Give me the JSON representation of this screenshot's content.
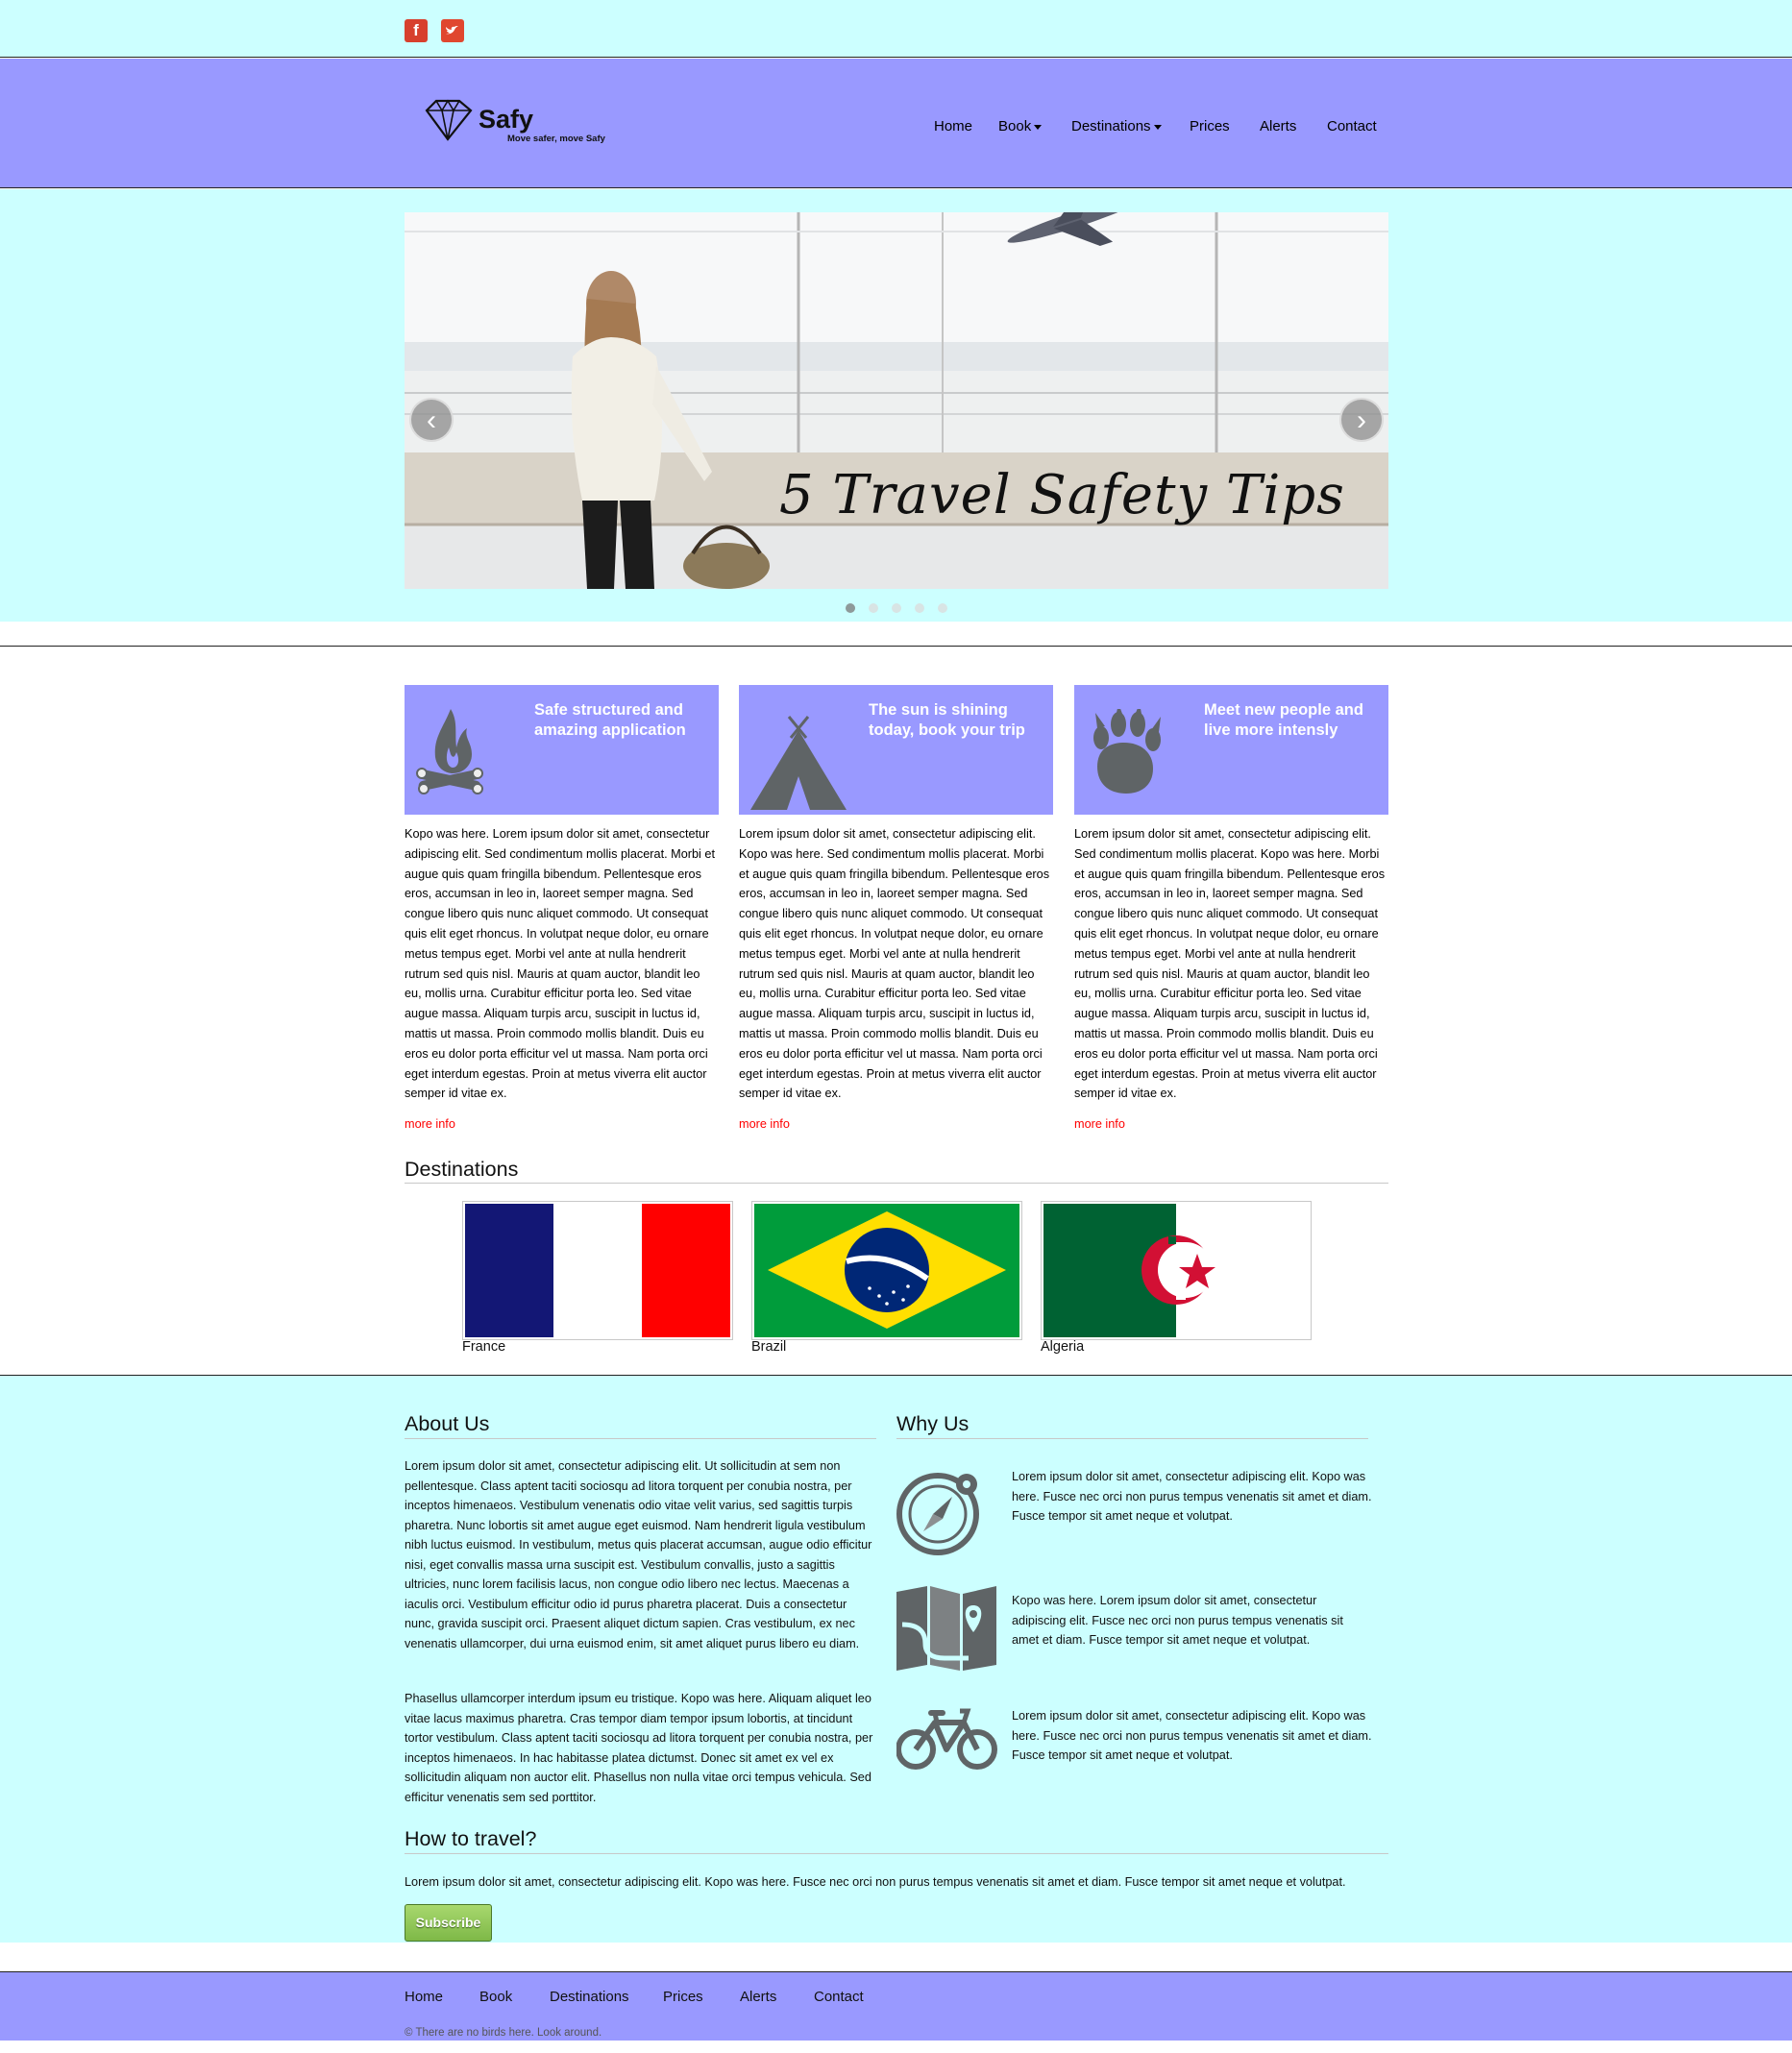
{
  "social": {
    "facebook": "f",
    "twitter": "t"
  },
  "logo": {
    "name": "Safy",
    "tagline": "Move safer, move Safy"
  },
  "nav": [
    {
      "label": "Home"
    },
    {
      "label": "Book"
    },
    {
      "label": "Destinations"
    },
    {
      "label": "Prices"
    },
    {
      "label": "Alerts"
    },
    {
      "label": "Contact"
    }
  ],
  "hero": {
    "caption": "5 Travel Safety Tips",
    "prev_icon": "chevron-left-icon",
    "next_icon": "chevron-right-icon",
    "slide_count": 5,
    "active_slide": 1
  },
  "features": [
    {
      "title": "Safe structured and amazing application",
      "icon": "campfire-icon",
      "text": "Kopo was here. Lorem ipsum dolor sit amet, consectetur adipiscing elit. Sed condimentum mollis placerat. Morbi et augue quis quam fringilla bibendum. Pellentesque eros eros, accumsan in leo in, laoreet semper magna. Sed congue libero quis nunc aliquet commodo. Ut consequat quis elit eget rhoncus. In volutpat neque dolor, eu ornare metus tempus eget. Morbi vel ante at nulla hendrerit rutrum sed quis nisl. Mauris at quam auctor, blandit leo eu, mollis urna. Curabitur efficitur porta leo. Sed vitae augue massa. Aliquam turpis arcu, suscipit in luctus id, mattis ut massa. Proin commodo mollis blandit. Duis eu eros eu dolor porta efficitur vel ut massa. Nam porta orci eget interdum egestas. Proin at metus viverra elit auctor semper id vitae ex.",
      "more": "more info"
    },
    {
      "title": "The sun is shining today, book your trip",
      "icon": "tent-icon",
      "text": "Lorem ipsum dolor sit amet, consectetur adipiscing elit. Kopo was here. Sed condimentum mollis placerat. Morbi et augue quis quam fringilla bibendum. Pellentesque eros eros, accumsan in leo in, laoreet semper magna. Sed congue libero quis nunc aliquet commodo. Ut consequat quis elit eget rhoncus. In volutpat neque dolor, eu ornare metus tempus eget. Morbi vel ante at nulla hendrerit rutrum sed quis nisl. Mauris at quam auctor, blandit leo eu, mollis urna. Curabitur efficitur porta leo. Sed vitae augue massa. Aliquam turpis arcu, suscipit in luctus id, mattis ut massa. Proin commodo mollis blandit. Duis eu eros eu dolor porta efficitur vel ut massa. Nam porta orci eget interdum egestas. Proin at metus viverra elit auctor semper id vitae ex.",
      "more": "more info"
    },
    {
      "title": "Meet new people and live more intensly",
      "icon": "paw-icon",
      "text": "Lorem ipsum dolor sit amet, consectetur adipiscing elit. Sed condimentum mollis placerat. Kopo was here. Morbi et augue quis quam fringilla bibendum. Pellentesque eros eros, accumsan in leo in, laoreet semper magna. Sed congue libero quis nunc aliquet commodo. Ut consequat quis elit eget rhoncus. In volutpat neque dolor, eu ornare metus tempus eget. Morbi vel ante at nulla hendrerit rutrum sed quis nisl. Mauris at quam auctor, blandit leo eu, mollis urna. Curabitur efficitur porta leo. Sed vitae augue massa. Aliquam turpis arcu, suscipit in luctus id, mattis ut massa. Proin commodo mollis blandit. Duis eu eros eu dolor porta efficitur vel ut massa. Nam porta orci eget interdum egestas. Proin at metus viverra elit auctor semper id vitae ex.",
      "more": "more info"
    }
  ],
  "destinations": {
    "heading": "Destinations",
    "items": [
      {
        "name": "France"
      },
      {
        "name": "Brazil"
      },
      {
        "name": "Algeria"
      }
    ]
  },
  "about": {
    "heading": "About Us",
    "p1": "Lorem ipsum dolor sit amet, consectetur adipiscing elit. Ut sollicitudin at sem non pellentesque. Class aptent taciti sociosqu ad litora torquent per conubia nostra, per inceptos himenaeos. Vestibulum venenatis odio vitae velit varius, sed sagittis turpis pharetra. Nunc lobortis sit amet augue eget euismod. Nam hendrerit ligula vestibulum nibh luctus euismod. In vestibulum, metus quis placerat accumsan, augue odio efficitur nisi, eget convallis massa urna suscipit est. Vestibulum convallis, justo a sagittis ultricies, nunc lorem facilisis lacus, non congue odio libero nec lectus. Maecenas a iaculis orci. Vestibulum efficitur odio id purus pharetra placerat. Duis a consectetur nunc, gravida suscipit orci. Praesent aliquet dictum sapien. Cras vestibulum, ex nec venenatis ullamcorper, dui urna euismod enim, sit amet aliquet purus libero eu diam.",
    "p2": "Phasellus ullamcorper interdum ipsum eu tristique. Kopo was here. Aliquam aliquet leo vitae lacus maximus pharetra. Cras tempor diam tempor ipsum lobortis, at tincidunt tortor vestibulum. Class aptent taciti sociosqu ad litora torquent per conubia nostra, per inceptos himenaeos. In hac habitasse platea dictumst. Donec sit amet ex vel ex sollicitudin aliquam non auctor elit. Phasellus non nulla vitae orci tempus vehicula. Sed efficitur venenatis sem sed porttitor."
  },
  "why": {
    "heading": "Why Us",
    "items": [
      {
        "icon": "compass-icon",
        "text": "Lorem ipsum dolor sit amet, consectetur adipiscing elit. Kopo was here. Fusce nec orci non purus tempus venenatis sit amet et diam. Fusce tempor sit amet neque et volutpat."
      },
      {
        "icon": "map-icon",
        "text": "Kopo was here. Lorem ipsum dolor sit amet, consectetur adipiscing elit. Fusce nec orci non purus tempus venenatis sit amet et diam. Fusce tempor sit amet neque et volutpat."
      },
      {
        "icon": "bicycle-icon",
        "text": "Lorem ipsum dolor sit amet, consectetur adipiscing elit. Kopo was here. Fusce nec orci non purus tempus venenatis sit amet et diam. Fusce tempor sit amet neque et volutpat."
      }
    ]
  },
  "travel": {
    "heading": "How to travel?",
    "text": "Lorem ipsum dolor sit amet, consectetur adipiscing elit. Kopo was here. Fusce nec orci non purus tempus venenatis sit amet et diam. Fusce tempor sit amet neque et volutpat.",
    "button": "Subscribe"
  },
  "footer": {
    "nav": [
      {
        "label": "Home"
      },
      {
        "label": "Book"
      },
      {
        "label": "Destinations"
      },
      {
        "label": "Prices"
      },
      {
        "label": "Alerts"
      },
      {
        "label": "Contact"
      }
    ],
    "copyright": "© There are no birds here. Look around."
  },
  "colors": {
    "light_band": "#ccffff",
    "purple_band": "#9999ff",
    "link_red": "#ff0000",
    "icon_gray": "#5f6466"
  }
}
